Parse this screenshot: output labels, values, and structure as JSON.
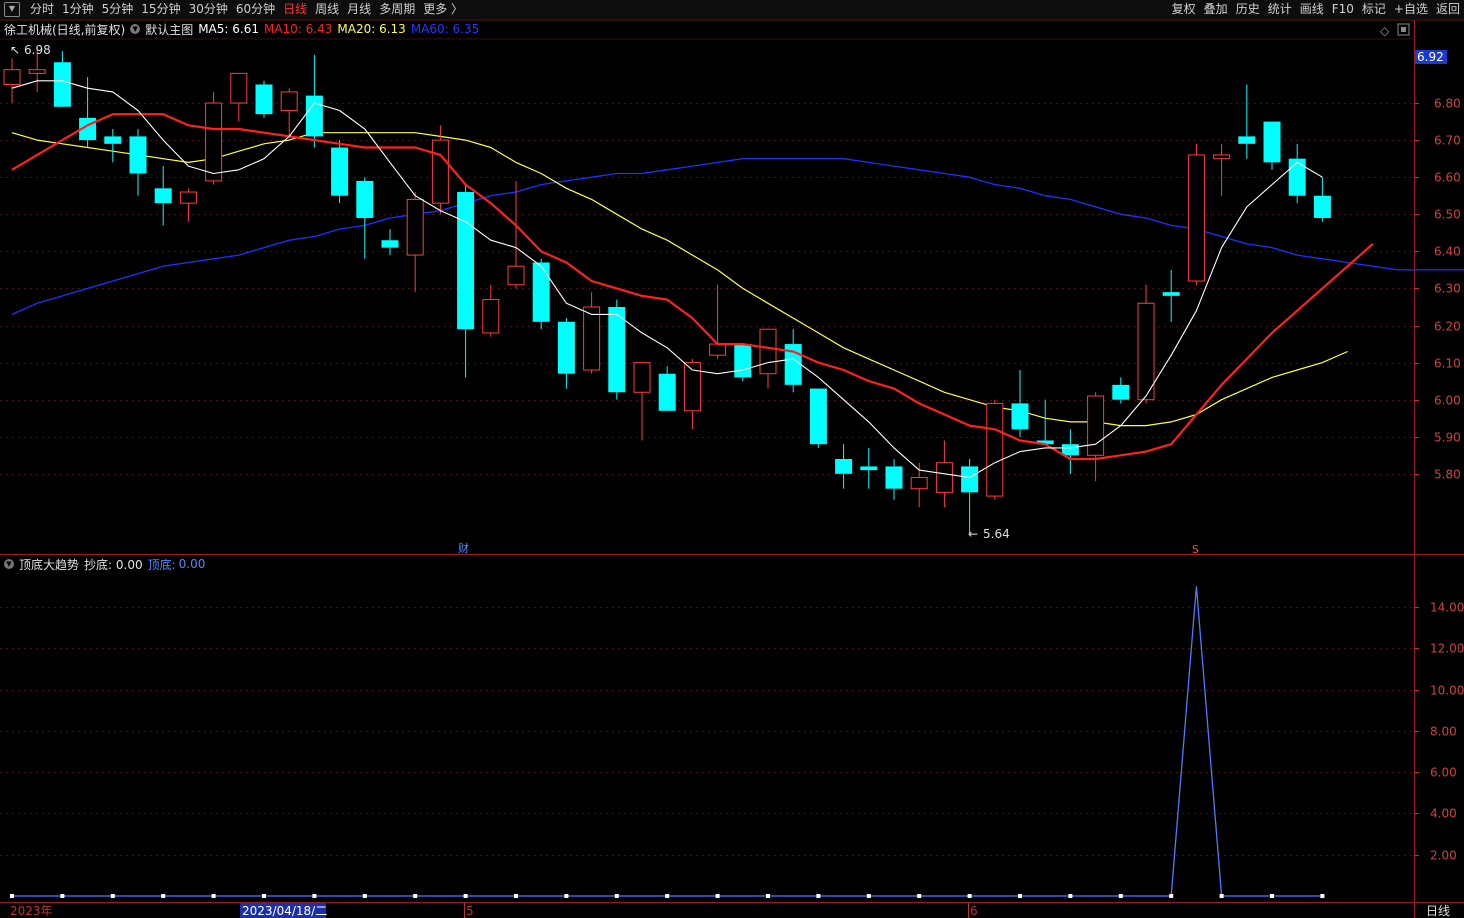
{
  "toolbar": {
    "period_tabs": [
      "分时",
      "1分钟",
      "5分钟",
      "15分钟",
      "30分钟",
      "60分钟",
      "日线",
      "周线",
      "月线",
      "多周期",
      "更多 〉"
    ],
    "active_period": "日线",
    "tool_tabs": [
      "复权",
      "叠加",
      "历史",
      "统计",
      "画线",
      "F10",
      "标记",
      "+自选",
      "返回"
    ]
  },
  "main_chart": {
    "stock_name": "徐工机械(日线,前复权)",
    "template": "默认主图",
    "ma5": "MA5: 6.61",
    "ma10": "MA10: 6.43",
    "ma20": "MA20: 6.13",
    "ma60": "MA60: 6.35",
    "current_price_tag": "6.92",
    "high_label": "6.98",
    "low_label": "5.64",
    "event_mark_cai": "财",
    "event_mark_s": "S",
    "diamond_icon": "◇",
    "colors": {
      "up": "#ff3b3b",
      "down": "#00ffff",
      "ma5": "#ffffff",
      "ma10": "#ff2020",
      "ma20": "#ffff40",
      "ma60": "#2030ff"
    }
  },
  "indicator": {
    "name": "顶底大趋势",
    "chaodi": "抄底: 0.00",
    "dingdi_label": "顶底:",
    "dingdi_value": "0.00"
  },
  "x_axis": {
    "labels": [
      "2023年",
      "2023/04/18/二",
      "5",
      "6"
    ],
    "period_label": "日线"
  },
  "chart_data": [
    {
      "type": "candlestick",
      "title": "徐工机械(日线,前复权)",
      "y_ticks": [
        5.8,
        5.9,
        6.0,
        6.1,
        6.2,
        6.3,
        6.4,
        6.5,
        6.6,
        6.7,
        6.8
      ],
      "ylim": [
        5.6,
        6.97
      ],
      "candles": [
        {
          "o": 6.85,
          "h": 6.92,
          "l": 6.8,
          "c": 6.89
        },
        {
          "o": 6.88,
          "h": 6.95,
          "l": 6.83,
          "c": 6.89
        },
        {
          "o": 6.91,
          "h": 6.94,
          "l": 6.8,
          "c": 6.79
        },
        {
          "o": 6.76,
          "h": 6.87,
          "l": 6.68,
          "c": 6.7
        },
        {
          "o": 6.71,
          "h": 6.73,
          "l": 6.64,
          "c": 6.69
        },
        {
          "o": 6.71,
          "h": 6.73,
          "l": 6.55,
          "c": 6.61
        },
        {
          "o": 6.57,
          "h": 6.63,
          "l": 6.47,
          "c": 6.53
        },
        {
          "o": 6.53,
          "h": 6.57,
          "l": 6.48,
          "c": 6.56
        },
        {
          "o": 6.59,
          "h": 6.83,
          "l": 6.58,
          "c": 6.8
        },
        {
          "o": 6.8,
          "h": 6.88,
          "l": 6.75,
          "c": 6.88
        },
        {
          "o": 6.85,
          "h": 6.86,
          "l": 6.76,
          "c": 6.77
        },
        {
          "o": 6.78,
          "h": 6.84,
          "l": 6.71,
          "c": 6.83
        },
        {
          "o": 6.82,
          "h": 6.93,
          "l": 6.68,
          "c": 6.71
        },
        {
          "o": 6.68,
          "h": 6.7,
          "l": 6.53,
          "c": 6.55
        },
        {
          "o": 6.59,
          "h": 6.6,
          "l": 6.38,
          "c": 6.49
        },
        {
          "o": 6.43,
          "h": 6.46,
          "l": 6.39,
          "c": 6.41
        },
        {
          "o": 6.39,
          "h": 6.56,
          "l": 6.29,
          "c": 6.54
        },
        {
          "o": 6.53,
          "h": 6.74,
          "l": 6.5,
          "c": 6.7
        },
        {
          "o": 6.56,
          "h": 6.58,
          "l": 6.06,
          "c": 6.19
        },
        {
          "o": 6.18,
          "h": 6.31,
          "l": 6.17,
          "c": 6.27
        },
        {
          "o": 6.31,
          "h": 6.59,
          "l": 6.3,
          "c": 6.36
        },
        {
          "o": 6.37,
          "h": 6.38,
          "l": 6.19,
          "c": 6.21
        },
        {
          "o": 6.21,
          "h": 6.22,
          "l": 6.03,
          "c": 6.07
        },
        {
          "o": 6.08,
          "h": 6.29,
          "l": 6.07,
          "c": 6.25
        },
        {
          "o": 6.25,
          "h": 6.27,
          "l": 6.0,
          "c": 6.02
        },
        {
          "o": 6.02,
          "h": 6.1,
          "l": 5.89,
          "c": 6.1
        },
        {
          "o": 6.07,
          "h": 6.09,
          "l": 5.97,
          "c": 5.97
        },
        {
          "o": 5.97,
          "h": 6.11,
          "l": 5.92,
          "c": 6.1
        },
        {
          "o": 6.12,
          "h": 6.31,
          "l": 6.11,
          "c": 6.15
        },
        {
          "o": 6.15,
          "h": 6.15,
          "l": 6.05,
          "c": 6.06
        },
        {
          "o": 6.07,
          "h": 6.19,
          "l": 6.03,
          "c": 6.19
        },
        {
          "o": 6.15,
          "h": 6.19,
          "l": 6.02,
          "c": 6.04
        },
        {
          "o": 6.03,
          "h": 6.03,
          "l": 5.87,
          "c": 5.88
        },
        {
          "o": 5.84,
          "h": 5.88,
          "l": 5.76,
          "c": 5.8
        },
        {
          "o": 5.82,
          "h": 5.87,
          "l": 5.76,
          "c": 5.81
        },
        {
          "o": 5.82,
          "h": 5.84,
          "l": 5.73,
          "c": 5.76
        },
        {
          "o": 5.76,
          "h": 5.83,
          "l": 5.71,
          "c": 5.79
        },
        {
          "o": 5.75,
          "h": 5.89,
          "l": 5.71,
          "c": 5.83
        },
        {
          "o": 5.82,
          "h": 5.84,
          "l": 5.64,
          "c": 5.75
        },
        {
          "o": 5.74,
          "h": 6.0,
          "l": 5.73,
          "c": 5.99
        },
        {
          "o": 5.99,
          "h": 6.08,
          "l": 5.9,
          "c": 5.92
        },
        {
          "o": 5.89,
          "h": 6.0,
          "l": 5.88,
          "c": 5.88
        },
        {
          "o": 5.88,
          "h": 5.92,
          "l": 5.8,
          "c": 5.85
        },
        {
          "o": 5.85,
          "h": 6.02,
          "l": 5.78,
          "c": 6.01
        },
        {
          "o": 6.04,
          "h": 6.06,
          "l": 5.99,
          "c": 6.0
        },
        {
          "o": 6.0,
          "h": 6.31,
          "l": 5.99,
          "c": 6.26
        },
        {
          "o": 6.29,
          "h": 6.35,
          "l": 6.21,
          "c": 6.28
        },
        {
          "o": 6.32,
          "h": 6.69,
          "l": 6.31,
          "c": 6.66
        },
        {
          "o": 6.65,
          "h": 6.69,
          "l": 6.55,
          "c": 6.66
        },
        {
          "o": 6.71,
          "h": 6.85,
          "l": 6.65,
          "c": 6.69
        },
        {
          "o": 6.75,
          "h": 6.75,
          "l": 6.62,
          "c": 6.64
        },
        {
          "o": 6.65,
          "h": 6.69,
          "l": 6.53,
          "c": 6.55
        },
        {
          "o": 6.55,
          "h": 6.6,
          "l": 6.48,
          "c": 6.49
        }
      ],
      "ma5": [
        6.84,
        6.86,
        6.86,
        6.84,
        6.83,
        6.78,
        6.7,
        6.63,
        6.61,
        6.62,
        6.65,
        6.71,
        6.8,
        6.78,
        6.73,
        6.64,
        6.55,
        6.51,
        6.48,
        6.43,
        6.41,
        6.36,
        6.26,
        6.23,
        6.23,
        6.18,
        6.14,
        6.08,
        6.07,
        6.08,
        6.1,
        6.11,
        6.06,
        6.0,
        5.94,
        5.87,
        5.81,
        5.8,
        5.79,
        5.83,
        5.86,
        5.87,
        5.87,
        5.88,
        5.93,
        6.01,
        6.12,
        6.24,
        6.41,
        6.52,
        6.58,
        6.64,
        6.6
      ],
      "ma10": [
        6.62,
        6.66,
        6.7,
        6.74,
        6.77,
        6.77,
        6.77,
        6.74,
        6.73,
        6.73,
        6.72,
        6.71,
        6.7,
        6.69,
        6.68,
        6.68,
        6.68,
        6.66,
        6.58,
        6.53,
        6.47,
        6.4,
        6.37,
        6.32,
        6.3,
        6.28,
        6.27,
        6.22,
        6.15,
        6.15,
        6.14,
        6.13,
        6.1,
        6.08,
        6.05,
        6.03,
        5.99,
        5.96,
        5.93,
        5.92,
        5.89,
        5.88,
        5.84,
        5.84,
        5.85,
        5.86,
        5.88,
        5.96,
        6.04,
        6.11,
        6.18,
        6.24,
        6.3,
        6.36,
        6.42
      ],
      "ma20": [
        6.72,
        6.7,
        6.69,
        6.68,
        6.67,
        6.66,
        6.65,
        6.64,
        6.65,
        6.67,
        6.69,
        6.7,
        6.72,
        6.72,
        6.72,
        6.72,
        6.72,
        6.71,
        6.7,
        6.68,
        6.64,
        6.61,
        6.57,
        6.54,
        6.5,
        6.46,
        6.43,
        6.39,
        6.35,
        6.3,
        6.26,
        6.22,
        6.18,
        6.14,
        6.11,
        6.08,
        6.05,
        6.02,
        6.0,
        5.98,
        5.97,
        5.95,
        5.94,
        5.94,
        5.93,
        5.93,
        5.94,
        5.96,
        6.0,
        6.03,
        6.06,
        6.08,
        6.1,
        6.13
      ],
      "ma60": [
        6.23,
        6.26,
        6.28,
        6.3,
        6.32,
        6.34,
        6.36,
        6.37,
        6.38,
        6.39,
        6.41,
        6.43,
        6.44,
        6.46,
        6.47,
        6.49,
        6.5,
        6.51,
        6.53,
        6.55,
        6.56,
        6.58,
        6.59,
        6.6,
        6.61,
        6.61,
        6.62,
        6.63,
        6.64,
        6.65,
        6.65,
        6.65,
        6.65,
        6.65,
        6.64,
        6.63,
        6.62,
        6.61,
        6.6,
        6.58,
        6.57,
        6.55,
        6.54,
        6.52,
        6.5,
        6.49,
        6.47,
        6.46,
        6.44,
        6.42,
        6.41,
        6.39,
        6.38,
        6.37,
        6.36,
        6.35,
        6.35,
        6.35,
        6.35,
        6.35
      ]
    },
    {
      "type": "line",
      "title": "顶底大趋势",
      "y_ticks": [
        2.0,
        4.0,
        6.0,
        8.0,
        10.0,
        12.0,
        14.0
      ],
      "ylim": [
        0,
        15.5
      ],
      "values": [
        0,
        0,
        0,
        0,
        0,
        0,
        0,
        0,
        0,
        0,
        0,
        0,
        0,
        0,
        0,
        0,
        0,
        0,
        0,
        0,
        0,
        0,
        0,
        0,
        0,
        0,
        0,
        0,
        0,
        0,
        0,
        0,
        0,
        0,
        0,
        0,
        0,
        0,
        0,
        0,
        0,
        0,
        0,
        0,
        0,
        0,
        0,
        15,
        0,
        0,
        0,
        0,
        0
      ]
    }
  ]
}
